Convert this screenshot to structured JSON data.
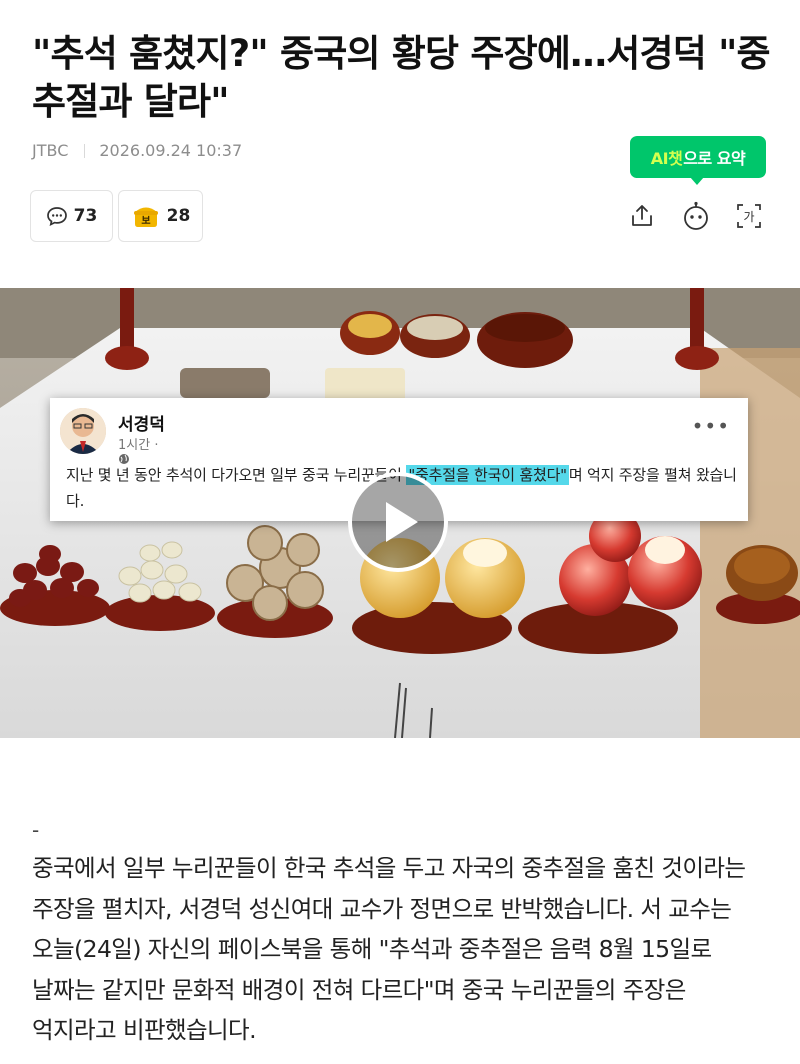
{
  "article": {
    "headline": "\"추석 훔쳤지?\" 중국의 황당 주장에…서경덕 \"중추절과 달라\"",
    "source": "JTBC",
    "datetime": "2026.09.24 10:37"
  },
  "ai_summary": {
    "label_prefix": "AI챗",
    "label_suffix": "으로 요약"
  },
  "reactions": {
    "comment_count": "73",
    "reaction_count": "28"
  },
  "toolbar": {
    "share_icon": "share-icon",
    "bot_icon": "chatbot-icon",
    "font_icon": "font-size-icon",
    "font_glyph": "가"
  },
  "video": {
    "post": {
      "name": "서경덕",
      "time": "1시간 · ",
      "text_before": "지난 몇 년 동안 추석이 다가오면 일부 중국 누리꾼들이 ",
      "text_highlight": "\"중추절을 한국이 훔쳤다\"",
      "text_after": "며 억지 주장을 펼쳐 왔습니다.",
      "more": "•••"
    },
    "play_icon": "play-icon"
  },
  "body": {
    "dash": "-",
    "paragraph": "중국에서 일부 누리꾼들이 한국 추석을 두고 자국의 중추절을 훔친 것이라는 주장을 펼치자, 서경덕 성신여대 교수가 정면으로 반박했습니다. 서 교수는 오늘(24일) 자신의 페이스북을 통해 \"추석과 중추절은 음력 8월 15일로 날짜는 같지만 문화적 배경이 전혀 다르다\"며 중국 누리꾼들의 주장은 억지라고 비판했습니다."
  },
  "colors": {
    "ai_green": "#00c66b",
    "ai_accent": "#d4ff4f",
    "highlight": "#55d8ea",
    "reaction_gold": "#f2b600"
  }
}
